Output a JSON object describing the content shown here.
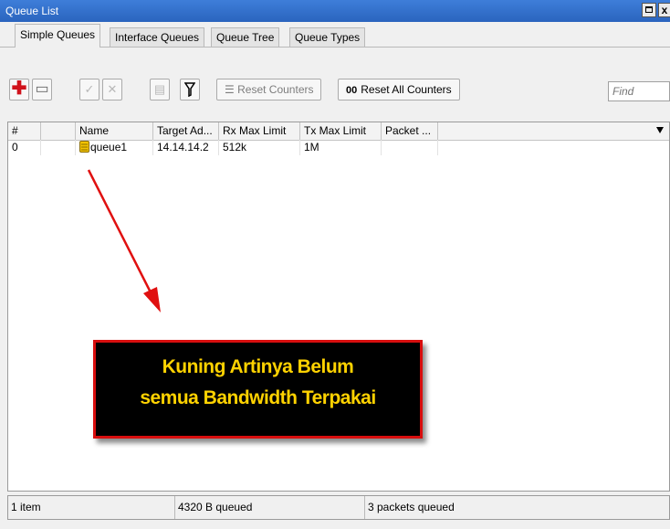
{
  "window": {
    "title": "Queue List",
    "close_label": "x"
  },
  "tabs": [
    {
      "label": "Simple Queues",
      "active": true
    },
    {
      "label": "Interface Queues",
      "active": false
    },
    {
      "label": "Queue Tree",
      "active": false
    },
    {
      "label": "Queue Types",
      "active": false
    }
  ],
  "toolbar": {
    "reset_counters_label": "Reset Counters",
    "reset_all_prefix": "00",
    "reset_all_label": "Reset All Counters",
    "find_placeholder": "Find",
    "icons": [
      "plus-icon",
      "minus-icon",
      "check-icon",
      "cross-icon",
      "note-icon",
      "filter-icon",
      "reset-icon"
    ]
  },
  "table": {
    "columns": [
      "#",
      "",
      "Name",
      "Target Ad...",
      "Rx Max Limit",
      "Tx Max Limit",
      "Packet ..."
    ],
    "rows": [
      {
        "num": "0",
        "flag": "",
        "name": "queue1",
        "target": "14.14.14.2",
        "rx_max": "512k",
        "tx_max": "1M",
        "packet": "",
        "icon_color": "#f2c200"
      }
    ]
  },
  "annotation": {
    "line1": "Kuning Artinya Belum",
    "line2": "semua Bandwidth Terpakai",
    "text_color": "#ffd200",
    "border_color": "#d80e0e",
    "arrow_color": "#e01010"
  },
  "status": {
    "items": "1 item",
    "queued_bytes": "4320 B queued",
    "queued_packets": "3 packets queued"
  }
}
